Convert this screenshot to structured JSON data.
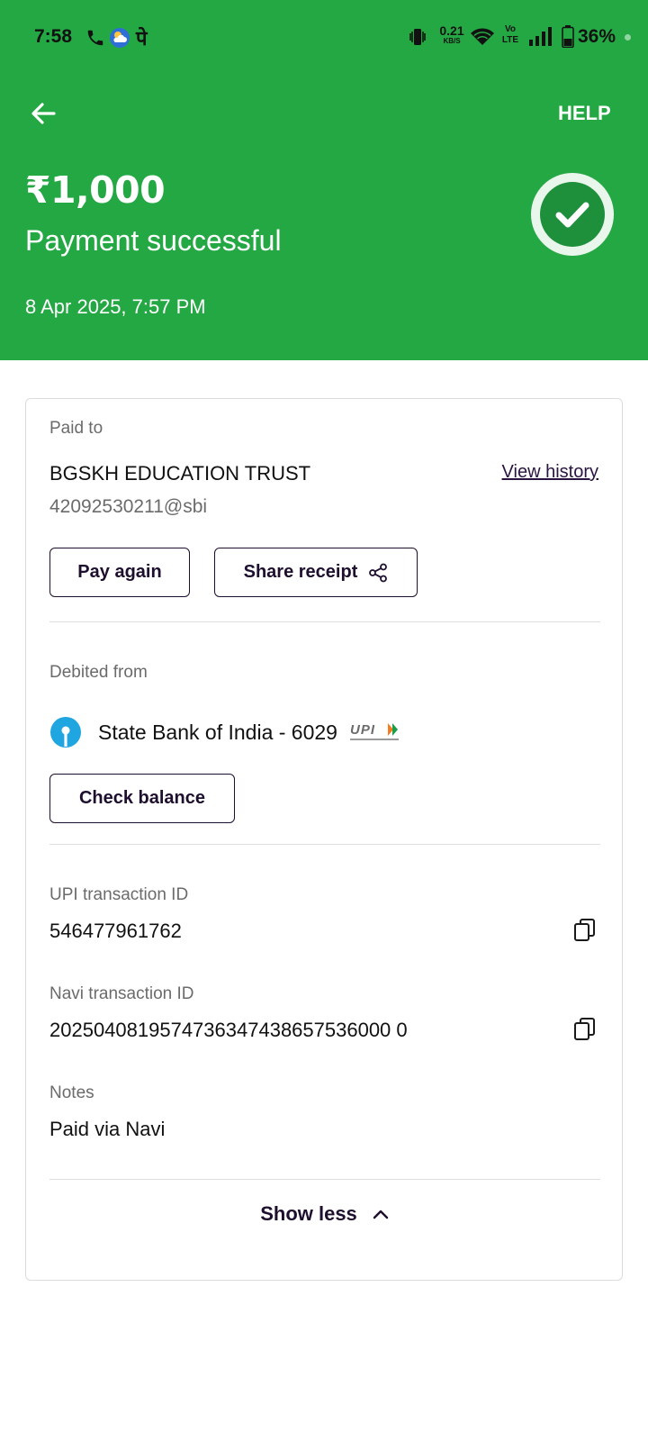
{
  "status_bar": {
    "time": "7:58",
    "carrier_glyph": "पे",
    "net_speed_value": "0.21",
    "net_speed_unit": "KB/S",
    "volte_top": "Vo",
    "volte_bottom": "LTE",
    "battery": "36%",
    "icons": [
      "phone-icon",
      "weather-icon",
      "vibrate-icon",
      "wifi-icon",
      "signal-icon",
      "battery-icon"
    ]
  },
  "header": {
    "help": "HELP",
    "amount": "₹1,000",
    "status": "Payment successful",
    "datetime": "8 Apr 2025, 7:57 PM",
    "background_color": "#24a843"
  },
  "paid_to": {
    "label": "Paid to",
    "name": "BGSKH EDUCATION TRUST",
    "vpa": "42092530211@sbi",
    "view_history": "View history",
    "pay_again": "Pay again",
    "share_receipt": "Share receipt"
  },
  "debited_from": {
    "label": "Debited from",
    "bank": "State Bank of India - 6029",
    "check_balance": "Check balance"
  },
  "details": {
    "upi_txn_label": "UPI transaction ID",
    "upi_txn_id": "546477961762",
    "navi_txn_label": "Navi transaction ID",
    "navi_txn_id": "2025040819574736347438657536000 0",
    "notes_label": "Notes",
    "notes": "Paid via Navi"
  },
  "show_less": "Show less"
}
